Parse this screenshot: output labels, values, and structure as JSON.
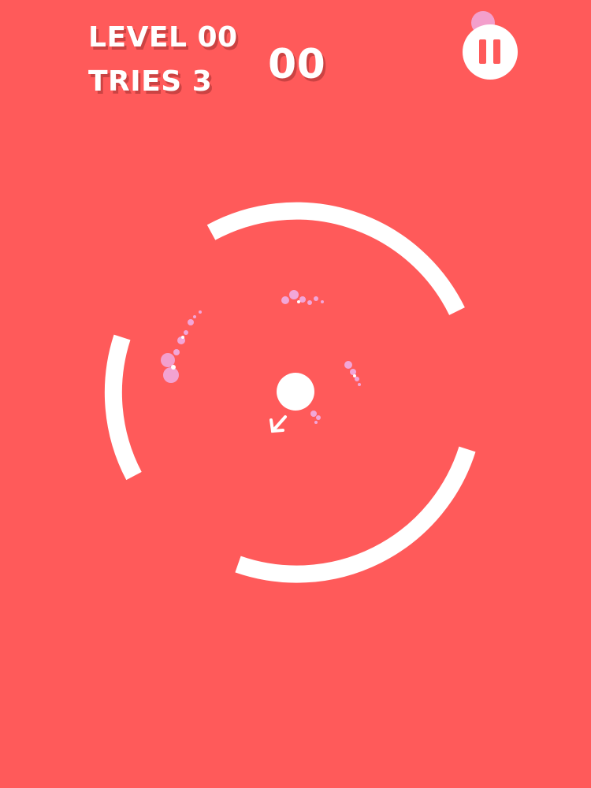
{
  "hud": {
    "level_label": "LEVEL 00",
    "tries_label": "TRIES 3",
    "score": "00"
  },
  "controls": {
    "pause_icon": "pause-icon"
  },
  "colors": {
    "background": "#FF5A5A",
    "foreground": "#FFFFFF",
    "particle": "#F2A6D8"
  },
  "game": {
    "ring_arcs": 4,
    "ball": "white-ball",
    "aim_indicator": "arrow-down-left"
  }
}
